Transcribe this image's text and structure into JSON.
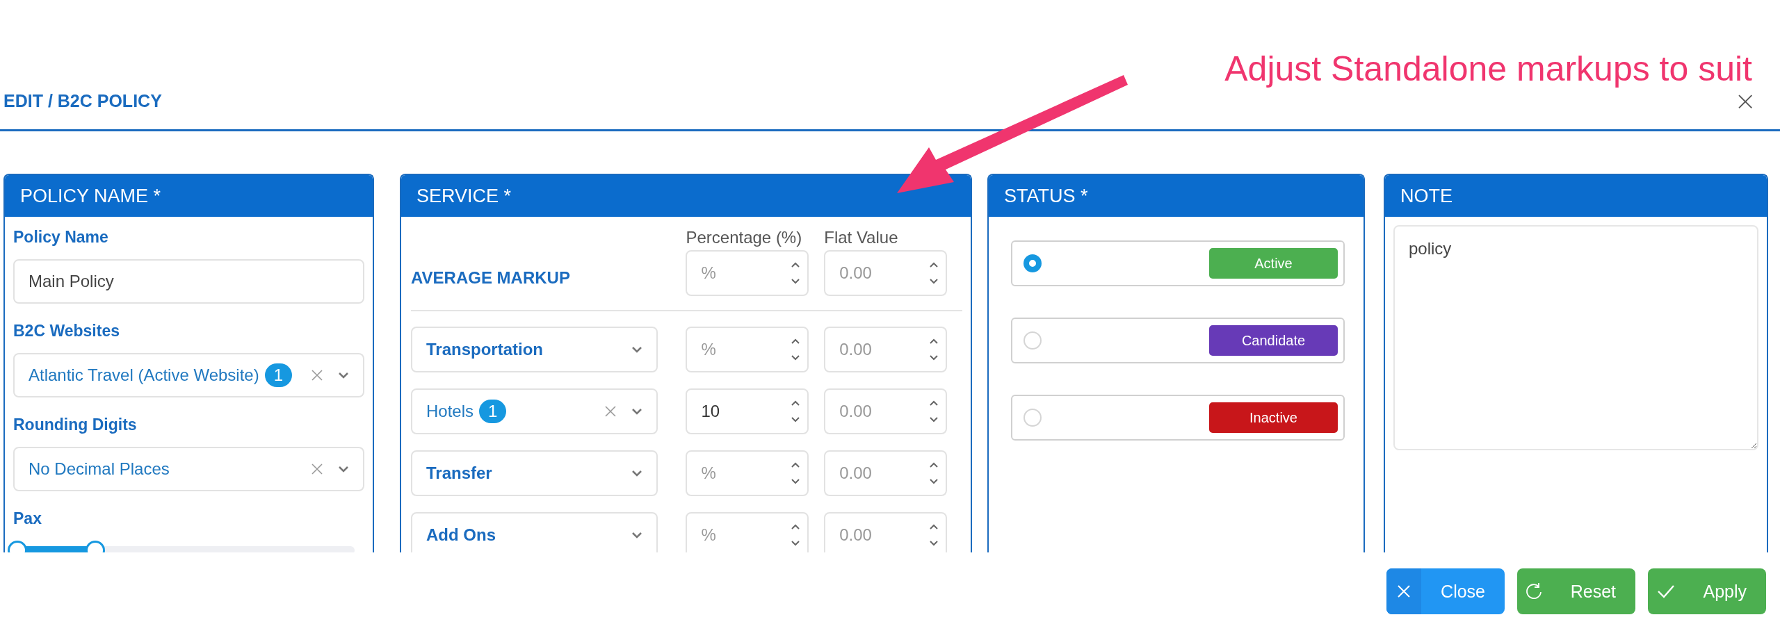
{
  "dialog": {
    "title": "EDIT / B2C POLICY",
    "close": "×"
  },
  "annotation": {
    "text": "Adjust Standalone markups to suit"
  },
  "policy_panel": {
    "header": "POLICY NAME *",
    "policy_name": {
      "label": "Policy Name",
      "value": "Main Policy"
    },
    "websites": {
      "label": "B2C Websites",
      "value": "Atlantic Travel (Active Website)",
      "count": "1"
    },
    "rounding": {
      "label": "Rounding Digits",
      "value": "No Decimal Places"
    },
    "pax": {
      "label": "Pax",
      "level": 0.23
    }
  },
  "service_panel": {
    "header": "SERVICE *",
    "columns": [
      "Percentage (%)",
      "Flat Value"
    ],
    "average": {
      "label": "AVERAGE MARKUP",
      "percentage": {
        "placeholder": "%"
      },
      "flat": {
        "placeholder": "0.00"
      }
    },
    "rows": [
      {
        "placeholder": "Transportation",
        "percentage": {
          "placeholder": "%"
        },
        "flat": {
          "placeholder": "0.00"
        }
      },
      {
        "value": "Hotels",
        "count": "1",
        "percentage": {
          "value": "10"
        },
        "flat": {
          "placeholder": "0.00"
        }
      },
      {
        "placeholder": "Transfer",
        "percentage": {
          "placeholder": "%"
        },
        "flat": {
          "placeholder": "0.00"
        }
      },
      {
        "placeholder": "Add Ons",
        "percentage": {
          "placeholder": "%"
        },
        "flat": {
          "placeholder": "0.00"
        }
      }
    ]
  },
  "status_panel": {
    "header": "STATUS *",
    "options": [
      {
        "label": "Active",
        "selected": true,
        "color": "#4caf50"
      },
      {
        "label": "Candidate",
        "selected": false,
        "color": "#673ab7"
      },
      {
        "label": "Inactive",
        "selected": false,
        "color": "#c8161a"
      }
    ]
  },
  "note_panel": {
    "header": "NOTE",
    "value": "policy"
  },
  "buttons": [
    {
      "kind": "close",
      "label": "Close"
    },
    {
      "kind": "reset",
      "label": "Reset"
    },
    {
      "kind": "apply",
      "label": "Apply"
    }
  ]
}
